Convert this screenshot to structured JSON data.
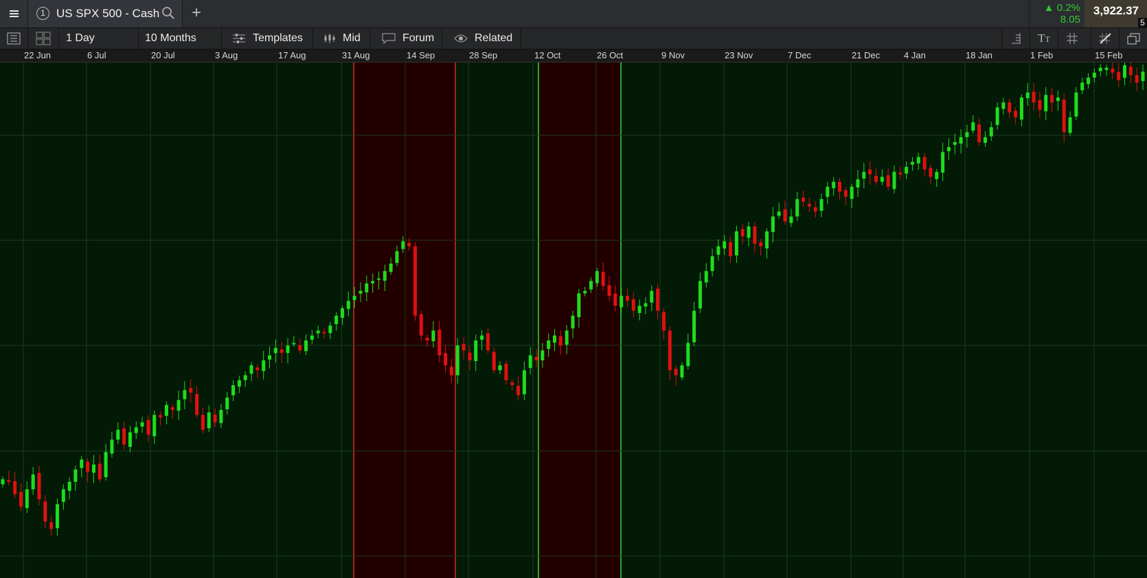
{
  "header": {
    "menu_icon": "hamburger-icon",
    "instrument_number": "1",
    "instrument_name": "US SPX 500 - Cash",
    "search_icon": "search-icon",
    "add_icon": "plus-icon",
    "change_pct": "▲ 0.2%",
    "change_abs": "8.05",
    "price": "3,922.37",
    "price_badge": "5"
  },
  "toolbar": {
    "layout_icon": "list-icon",
    "grid_icon": "grid-layout-icon",
    "interval": "1 Day",
    "range": "10 Months",
    "templates": "Templates",
    "price_type": "Mid",
    "forum": "Forum",
    "related": "Related",
    "right_icons": [
      "price-scale-icon",
      "text-size-icon",
      "grid-icon",
      "drawing-tools-icon",
      "detach-window-icon"
    ]
  },
  "time_axis": [
    "22 Jun",
    "6 Jul",
    "20 Jul",
    "3 Aug",
    "17 Aug",
    "31 Aug",
    "14 Sep",
    "28 Sep",
    "12 Oct",
    "26 Oct",
    "9 Nov",
    "23 Nov",
    "7 Dec",
    "21 Dec",
    "4 Jan",
    "18 Jan",
    "1 Feb",
    "15 Feb"
  ],
  "colors": {
    "up": "#1fdc1f",
    "down": "#e01010",
    "background": "#021a06",
    "bear_zone": "#220000",
    "bear_border": "#ff2a2a",
    "bull_border": "#3aff3a"
  },
  "chart_data": {
    "type": "candlestick",
    "symbol": "US SPX 500 - Cash",
    "interval": "1 Day",
    "ohlc_approx": "close series approximated from image; y axis unlabeled",
    "closes": [
      3100,
      3095,
      3070,
      3045,
      3080,
      3110,
      3060,
      3015,
      3000,
      3050,
      3080,
      3095,
      3120,
      3140,
      3115,
      3130,
      3100,
      3155,
      3180,
      3200,
      3170,
      3195,
      3205,
      3215,
      3190,
      3230,
      3225,
      3250,
      3240,
      3260,
      3280,
      3275,
      3230,
      3200,
      3235,
      3215,
      3240,
      3265,
      3290,
      3300,
      3310,
      3330,
      3320,
      3340,
      3350,
      3365,
      3355,
      3370,
      3375,
      3360,
      3380,
      3390,
      3400,
      3395,
      3410,
      3430,
      3445,
      3460,
      3470,
      3480,
      3495,
      3500,
      3505,
      3520,
      3535,
      3560,
      3580,
      3570,
      3430,
      3390,
      3380,
      3400,
      3350,
      3330,
      3310,
      3370,
      3360,
      3340,
      3380,
      3390,
      3360,
      3320,
      3330,
      3300,
      3290,
      3270,
      3320,
      3350,
      3340,
      3360,
      3380,
      3390,
      3370,
      3400,
      3430,
      3475,
      3480,
      3500,
      3520,
      3490,
      3470,
      3450,
      3470,
      3460,
      3440,
      3450,
      3455,
      3480,
      3440,
      3400,
      3320,
      3310,
      3330,
      3375,
      3440,
      3500,
      3520,
      3550,
      3570,
      3580,
      3550,
      3600,
      3590,
      3610,
      3575,
      3570,
      3600,
      3630,
      3640,
      3620,
      3630,
      3665,
      3660,
      3650,
      3640,
      3665,
      3690,
      3700,
      3680,
      3670,
      3690,
      3705,
      3720,
      3715,
      3700,
      3710,
      3690,
      3720,
      3715,
      3730,
      3740,
      3750,
      3725,
      3710,
      3720,
      3760,
      3770,
      3780,
      3790,
      3800,
      3820,
      3780,
      3790,
      3810,
      3850,
      3860,
      3840,
      3830,
      3870,
      3880,
      3860,
      3845,
      3875,
      3860,
      3870,
      3800,
      3830,
      3880,
      3900,
      3910,
      3920,
      3930,
      3930,
      3920,
      3905,
      3935,
      3915,
      3900,
      3922
    ]
  }
}
